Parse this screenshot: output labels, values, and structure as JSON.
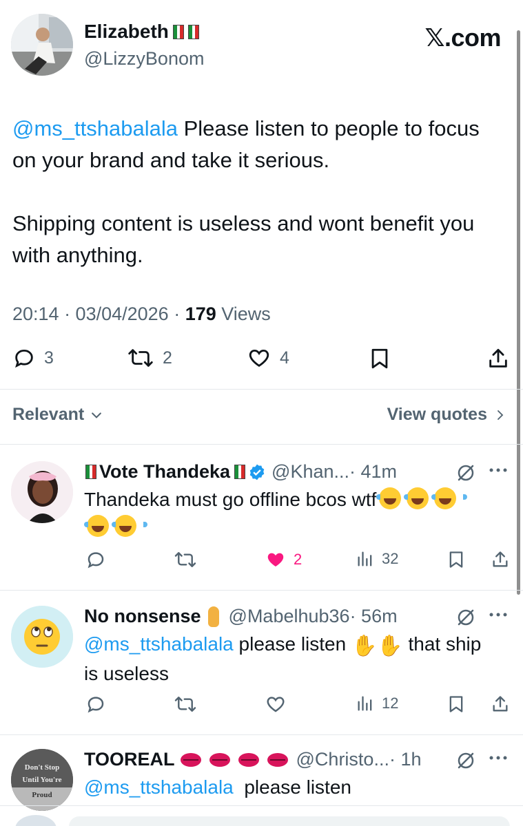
{
  "brand": "𝕏.com",
  "tweet": {
    "author_name": "Elizabeth",
    "author_handle": "@LizzyBonom",
    "mention": "@ms_ttshabalala",
    "text_line1_rest": " Please listen to people to focus on your brand and take it serious.",
    "text_para2": "Shipping content is useless and wont benefit you with anything.",
    "time": "20:14 · 03/04/2026 · ",
    "views_count": "179",
    "views_label": " Views",
    "reply_count": "3",
    "retweet_count": "2",
    "like_count": "4"
  },
  "sort": {
    "label": "Relevant",
    "view_quotes": "View quotes"
  },
  "replies": [
    {
      "name": "Vote Thandeka",
      "handle": "@Khan...",
      "time": " · 41m",
      "text": "Thandeka must go offline bcos wtf",
      "like_count": "2",
      "views": "32",
      "liked": true
    },
    {
      "name": "No nonsense",
      "handle": "@Mabelhub36",
      "time": " · 56m",
      "mention": "@ms_ttshabalala",
      "text_mid": " please listen ",
      "text_end": " that ship is useless",
      "views": "12"
    },
    {
      "name": "TOOREAL",
      "handle": "@Christo...",
      "time": " · 1h",
      "mention": "@ms_ttshabalala",
      "text": "  please listen",
      "avatar_text": [
        "Don't Stop",
        "Until You're",
        "Proud"
      ]
    }
  ],
  "colors": {
    "accent": "#1d9bf0",
    "like": "#f91880",
    "secondary": "#536471",
    "verified": "#1d9bf0"
  }
}
